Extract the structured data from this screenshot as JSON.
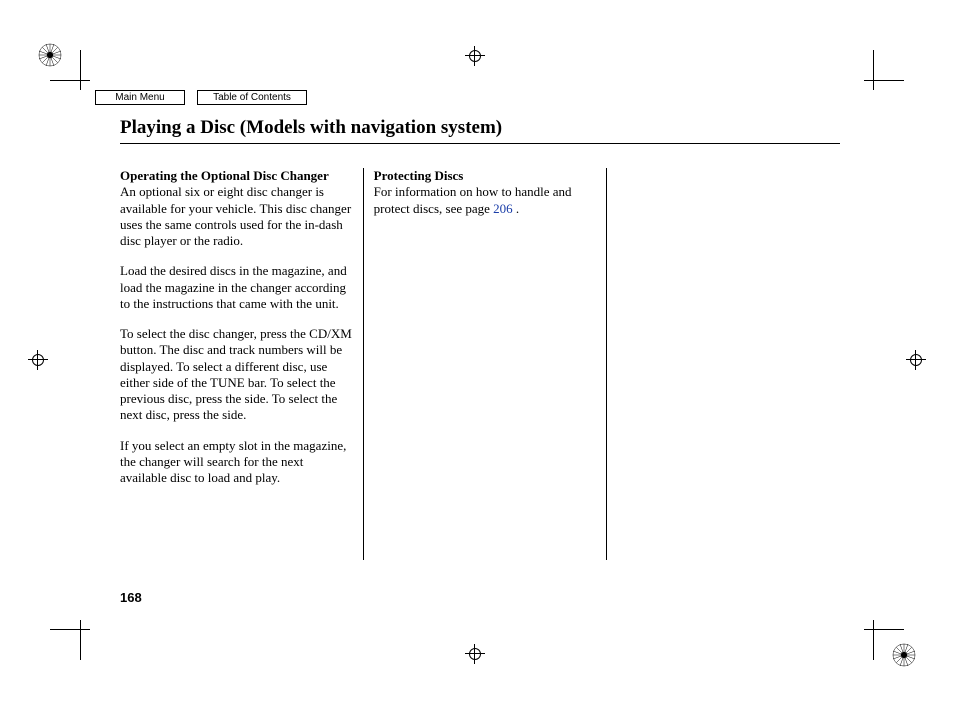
{
  "nav": {
    "main_menu": "Main Menu",
    "toc": "Table of Contents"
  },
  "title": "Playing a Disc (Models with navigation system)",
  "col1": {
    "heading": "Operating the Optional Disc Changer",
    "p1": "An optional six or eight disc changer is available for your vehicle. This disc changer uses the same controls used for the in-dash disc player or the radio.",
    "p2": "Load the desired discs in the magazine, and load the magazine in the changer according to the instructions that came with the unit.",
    "p3": "To select the disc changer, press the CD/XM button. The disc and track numbers will be displayed. To select a different disc, use either side of the TUNE bar. To select the previous disc, press the      side. To select the next disc, press the      side.",
    "p4": "If you select an empty slot in the magazine, the changer will search for the next available disc to load and play."
  },
  "col2": {
    "heading": "Protecting Discs",
    "p1a": "For information on how to handle and protect discs, see page ",
    "link": "206",
    "p1b": " ."
  },
  "page_number": "168"
}
